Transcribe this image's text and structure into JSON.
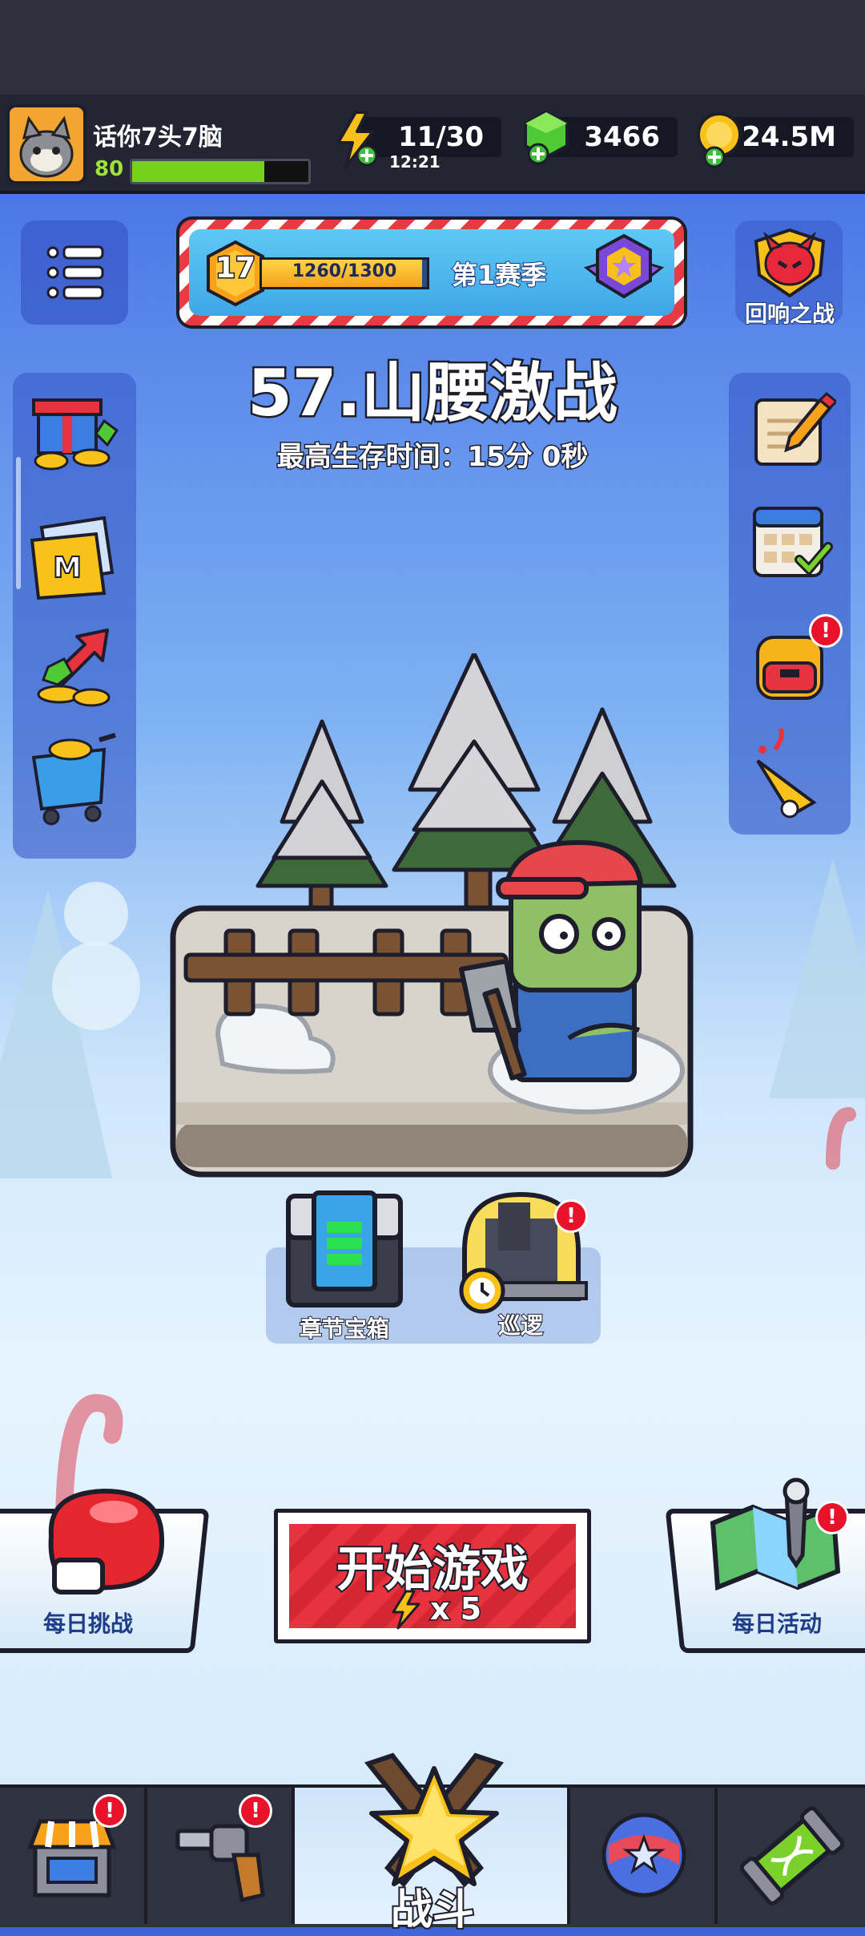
{
  "player": {
    "name": "话你7头7脑",
    "level": "80",
    "xp_fraction": 0.75
  },
  "resources": {
    "energy": {
      "value": "11/30",
      "timer": "12:21",
      "icon": "lightning-icon"
    },
    "gems": {
      "value": "3466",
      "icon": "green-gem-icon"
    },
    "coins": {
      "value": "24.5M",
      "icon": "gold-coin-icon"
    }
  },
  "season": {
    "rank": "17",
    "progress": "1260/1300",
    "progress_fraction": 0.969,
    "label": "第1赛季"
  },
  "echo_battle": {
    "label": "回响之战"
  },
  "stage": {
    "title": "57.山腰激战",
    "best_time": "最高生存时间：15分 0秒"
  },
  "chapter_chest": {
    "label": "章节宝箱"
  },
  "patrol": {
    "label": "巡逻"
  },
  "daily_challenge": {
    "label": "每日挑战"
  },
  "daily_events": {
    "label": "每日活动"
  },
  "start_button": {
    "label": "开始游戏",
    "cost": "x 5"
  },
  "nav": {
    "battle_label": "战斗"
  },
  "colors": {
    "start_red": "#e8333f",
    "accent_yellow": "#f8c21a",
    "panel_blue": "#3e5fcf"
  }
}
